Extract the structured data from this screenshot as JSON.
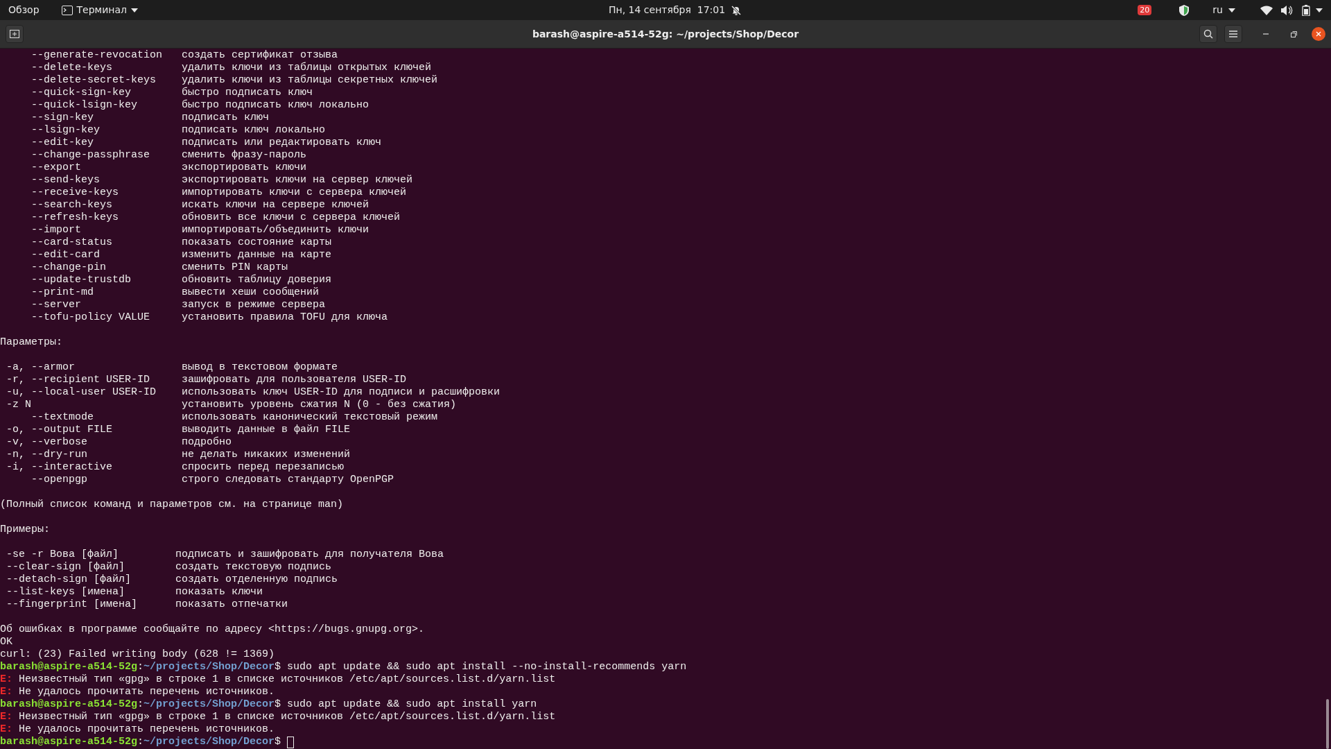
{
  "top_bar": {
    "activities": "Обзор",
    "app_menu": "Терминал",
    "clock": "Пн, 14 сентября  17:01",
    "notification_count": "20",
    "language": "ru"
  },
  "window": {
    "title": "barash@aspire-a514-52g: ~/projects/Shop/Decor"
  },
  "terminal": {
    "lines": [
      {
        "kind": "long-option",
        "flag": "--generate-revocation",
        "text": "создать сертификат отзыва"
      },
      {
        "kind": "long-option",
        "flag": "--delete-keys",
        "text": "удалить ключи из таблицы открытых ключей"
      },
      {
        "kind": "long-option",
        "flag": "--delete-secret-keys",
        "text": "удалить ключи из таблицы секретных ключей"
      },
      {
        "kind": "long-option",
        "flag": "--quick-sign-key",
        "text": "быстро подписать ключ"
      },
      {
        "kind": "long-option",
        "flag": "--quick-lsign-key",
        "text": "быстро подписать ключ локально"
      },
      {
        "kind": "long-option",
        "flag": "--sign-key",
        "text": "подписать ключ"
      },
      {
        "kind": "long-option",
        "flag": "--lsign-key",
        "text": "подписать ключ локально"
      },
      {
        "kind": "long-option",
        "flag": "--edit-key",
        "text": "подписать или редактировать ключ"
      },
      {
        "kind": "long-option",
        "flag": "--change-passphrase",
        "text": "сменить фразу-пароль"
      },
      {
        "kind": "long-option",
        "flag": "--export",
        "text": "экспортировать ключи"
      },
      {
        "kind": "long-option",
        "flag": "--send-keys",
        "text": "экспортировать ключи на сервер ключей"
      },
      {
        "kind": "long-option",
        "flag": "--receive-keys",
        "text": "импортировать ключи с сервера ключей"
      },
      {
        "kind": "long-option",
        "flag": "--search-keys",
        "text": "искать ключи на сервере ключей"
      },
      {
        "kind": "long-option",
        "flag": "--refresh-keys",
        "text": "обновить все ключи с сервера ключей"
      },
      {
        "kind": "long-option",
        "flag": "--import",
        "text": "импортировать/объединить ключи"
      },
      {
        "kind": "long-option",
        "flag": "--card-status",
        "text": "показать состояние карты"
      },
      {
        "kind": "long-option",
        "flag": "--edit-card",
        "text": "изменить данные на карте"
      },
      {
        "kind": "long-option",
        "flag": "--change-pin",
        "text": "сменить PIN карты"
      },
      {
        "kind": "long-option",
        "flag": "--update-trustdb",
        "text": "обновить таблицу доверия"
      },
      {
        "kind": "long-option",
        "flag": "--print-md",
        "text": "вывести хеши сообщений"
      },
      {
        "kind": "long-option",
        "flag": "--server",
        "text": "запуск в режиме сервера"
      },
      {
        "kind": "long-option",
        "flag": "--tofu-policy VALUE",
        "text": "установить правила TOFU для ключа"
      },
      {
        "kind": "blank"
      },
      {
        "kind": "text",
        "text": "Параметры:"
      },
      {
        "kind": "blank"
      },
      {
        "kind": "option",
        "flag": "-a, --armor",
        "text": "вывод в текстовом формате"
      },
      {
        "kind": "option",
        "flag": "-r, --recipient USER-ID",
        "text": "зашифровать для пользователя USER-ID"
      },
      {
        "kind": "option",
        "flag": "-u, --local-user USER-ID",
        "text": "использовать ключ USER-ID для подписи и расшифровки"
      },
      {
        "kind": "option",
        "flag": "-z N",
        "text": "установить уровень сжатия N (0 - без сжатия)"
      },
      {
        "kind": "long-option",
        "flag": "--textmode",
        "text": "использовать канонический текстовый режим"
      },
      {
        "kind": "option",
        "flag": "-o, --output FILE",
        "text": "выводить данные в файл FILE"
      },
      {
        "kind": "option",
        "flag": "-v, --verbose",
        "text": "подробно"
      },
      {
        "kind": "option",
        "flag": "-n, --dry-run",
        "text": "не делать никаких изменений"
      },
      {
        "kind": "option",
        "flag": "-i, --interactive",
        "text": "спросить перед перезаписью"
      },
      {
        "kind": "long-option",
        "flag": "--openpgp",
        "text": "строго следовать стандарту OpenPGP"
      },
      {
        "kind": "blank"
      },
      {
        "kind": "text",
        "text": "(Полный список команд и параметров см. на странице man)"
      },
      {
        "kind": "blank"
      },
      {
        "kind": "text",
        "text": "Примеры:"
      },
      {
        "kind": "blank"
      },
      {
        "kind": "example",
        "flag": "-se -r Вова [файл]",
        "text": "подписать и зашифровать для получателя Вова"
      },
      {
        "kind": "example",
        "flag": "--clear-sign [файл]",
        "text": "создать текстовую подпись"
      },
      {
        "kind": "example",
        "flag": "--detach-sign [файл]",
        "text": "создать отделенную подпись"
      },
      {
        "kind": "example",
        "flag": "--list-keys [имена]",
        "text": "показать ключи"
      },
      {
        "kind": "example",
        "flag": "--fingerprint [имена]",
        "text": "показать отпечатки"
      },
      {
        "kind": "blank"
      },
      {
        "kind": "text",
        "text": "Об ошибках в программе сообщайте по адресу <https://bugs.gnupg.org>."
      },
      {
        "kind": "text",
        "text": "OK"
      },
      {
        "kind": "text",
        "text": "curl: (23) Failed writing body (628 != 1369)"
      },
      {
        "kind": "prompt",
        "user": "barash@aspire-a514-52g",
        "separator": ":",
        "path": "~/projects/Shop/Decor",
        "symbol": "$",
        "command": "sudo apt update && sudo apt install --no-install-recommends yarn"
      },
      {
        "kind": "error",
        "tag": "E:",
        "text": "Неизвестный тип «gpg» в строке 1 в списке источников /etc/apt/sources.list.d/yarn.list"
      },
      {
        "kind": "error",
        "tag": "E:",
        "text": "Не удалось прочитать перечень источников."
      },
      {
        "kind": "prompt",
        "user": "barash@aspire-a514-52g",
        "separator": ":",
        "path": "~/projects/Shop/Decor",
        "symbol": "$",
        "command": "sudo apt update && sudo apt install yarn"
      },
      {
        "kind": "error",
        "tag": "E:",
        "text": "Неизвестный тип «gpg» в строке 1 в списке источников /etc/apt/sources.list.d/yarn.list"
      },
      {
        "kind": "error",
        "tag": "E:",
        "text": "Не удалось прочитать перечень источников."
      },
      {
        "kind": "prompt",
        "user": "barash@aspire-a514-52g",
        "separator": ":",
        "path": "~/projects/Shop/Decor",
        "symbol": "$",
        "cursor": true
      }
    ]
  }
}
